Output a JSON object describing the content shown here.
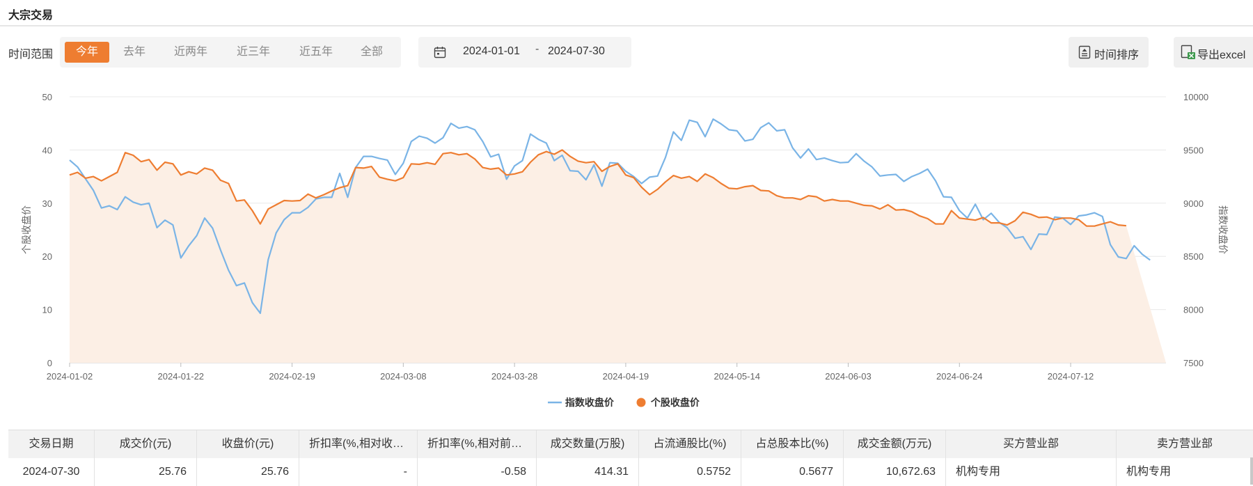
{
  "page": {
    "title": "大宗交易"
  },
  "filter": {
    "label": "时间范围",
    "tabs": [
      "今年",
      "去年",
      "近两年",
      "近三年",
      "近五年",
      "全部"
    ],
    "active_tab": "今年",
    "date_start": "2024-01-01",
    "date_sep": "-",
    "date_end": "2024-07-30"
  },
  "toolbar": {
    "sort_label": "时间排序",
    "sort_icon": "sort-doc-icon",
    "export_label": "导出excel",
    "export_icon": "excel-icon"
  },
  "chart_data": {
    "type": "line",
    "x": [
      "2024-01-02",
      "2024-01-03",
      "2024-01-04",
      "2024-01-05",
      "2024-01-08",
      "2024-01-09",
      "2024-01-10",
      "2024-01-11",
      "2024-01-12",
      "2024-01-15",
      "2024-01-16",
      "2024-01-17",
      "2024-01-18",
      "2024-01-19",
      "2024-01-22",
      "2024-01-23",
      "2024-01-24",
      "2024-01-25",
      "2024-01-26",
      "2024-01-29",
      "2024-01-30",
      "2024-01-31",
      "2024-02-01",
      "2024-02-02",
      "2024-02-05",
      "2024-02-06",
      "2024-02-07",
      "2024-02-08",
      "2024-02-19",
      "2024-02-20",
      "2024-02-21",
      "2024-02-22",
      "2024-02-23",
      "2024-02-26",
      "2024-02-27",
      "2024-02-28",
      "2024-02-29",
      "2024-03-01",
      "2024-03-04",
      "2024-03-05",
      "2024-03-06",
      "2024-03-07",
      "2024-03-08",
      "2024-03-11",
      "2024-03-12",
      "2024-03-13",
      "2024-03-14",
      "2024-03-15",
      "2024-03-18",
      "2024-03-19",
      "2024-03-20",
      "2024-03-21",
      "2024-03-22",
      "2024-03-25",
      "2024-03-26",
      "2024-03-27",
      "2024-03-28",
      "2024-03-29",
      "2024-04-01",
      "2024-04-02",
      "2024-04-03",
      "2024-04-08",
      "2024-04-09",
      "2024-04-10",
      "2024-04-11",
      "2024-04-12",
      "2024-04-15",
      "2024-04-16",
      "2024-04-17",
      "2024-04-18",
      "2024-04-19",
      "2024-04-22",
      "2024-04-23",
      "2024-04-24",
      "2024-04-25",
      "2024-04-26",
      "2024-04-29",
      "2024-04-30",
      "2024-05-06",
      "2024-05-07",
      "2024-05-08",
      "2024-05-09",
      "2024-05-10",
      "2024-05-13",
      "2024-05-14",
      "2024-05-15",
      "2024-05-16",
      "2024-05-17",
      "2024-05-20",
      "2024-05-21",
      "2024-05-22",
      "2024-05-23",
      "2024-05-24",
      "2024-05-27",
      "2024-05-28",
      "2024-05-29",
      "2024-05-30",
      "2024-05-31",
      "2024-06-03",
      "2024-06-04",
      "2024-06-05",
      "2024-06-06",
      "2024-06-07",
      "2024-06-11",
      "2024-06-12",
      "2024-06-13",
      "2024-06-14",
      "2024-06-17",
      "2024-06-18",
      "2024-06-19",
      "2024-06-20",
      "2024-06-21",
      "2024-06-24",
      "2024-06-25",
      "2024-06-26",
      "2024-06-27",
      "2024-06-28",
      "2024-07-01",
      "2024-07-02",
      "2024-07-03",
      "2024-07-04",
      "2024-07-05",
      "2024-07-08",
      "2024-07-09",
      "2024-07-10",
      "2024-07-11",
      "2024-07-12",
      "2024-07-15",
      "2024-07-16",
      "2024-07-17",
      "2024-07-18",
      "2024-07-19",
      "2024-07-22",
      "2024-07-23",
      "2024-07-24",
      "2024-07-25",
      "2024-07-26",
      "2024-07-29",
      "2024-07-30"
    ],
    "xticks": [
      "2024-01-02",
      "2024-01-22",
      "2024-02-19",
      "2024-03-08",
      "2024-03-28",
      "2024-04-19",
      "2024-05-14",
      "2024-06-03",
      "2024-06-24",
      "2024-07-12"
    ],
    "ylabel_left": "个股收盘价",
    "ylabel_right": "指数收盘价",
    "ylim_left": [
      0,
      50
    ],
    "ylim_right": [
      7500,
      10000
    ],
    "yticks_left": [
      0,
      10,
      20,
      30,
      40,
      50
    ],
    "yticks_right": [
      7500,
      8000,
      8500,
      9000,
      9500,
      10000
    ],
    "grid": true,
    "legend_position": "bottom-center",
    "series": [
      {
        "name": "指数收盘价",
        "axis": "right",
        "color": "#7ab4e6",
        "values": [
          9405,
          9340,
          9230,
          9120,
          8955,
          8975,
          8940,
          9060,
          9010,
          8985,
          9000,
          8770,
          8840,
          8795,
          8485,
          8600,
          8695,
          8860,
          8765,
          8560,
          8370,
          8225,
          8250,
          8065,
          7965,
          8470,
          8720,
          8845,
          8910,
          8910,
          8960,
          9040,
          9055,
          9055,
          9280,
          9055,
          9335,
          9440,
          9440,
          9420,
          9405,
          9270,
          9375,
          9580,
          9630,
          9610,
          9565,
          9615,
          9750,
          9705,
          9720,
          9690,
          9580,
          9435,
          9460,
          9225,
          9350,
          9400,
          9650,
          9600,
          9565,
          9400,
          9450,
          9305,
          9300,
          9220,
          9360,
          9160,
          9380,
          9375,
          9300,
          9250,
          9185,
          9245,
          9255,
          9430,
          9670,
          9590,
          9780,
          9760,
          9625,
          9790,
          9745,
          9690,
          9680,
          9585,
          9600,
          9710,
          9755,
          9680,
          9690,
          9520,
          9425,
          9510,
          9410,
          9425,
          9400,
          9380,
          9385,
          9465,
          9395,
          9340,
          9255,
          9265,
          9270,
          9205,
          9250,
          9280,
          9320,
          9210,
          9060,
          9055,
          8930,
          8860,
          8990,
          8845,
          8905,
          8820,
          8770,
          8670,
          8685,
          8565,
          8710,
          8705,
          8870,
          8860,
          8800,
          8880,
          8890,
          8910,
          8875,
          8610,
          8495,
          8480,
          8600,
          8520,
          8465
        ],
        "color_name": "blue"
      },
      {
        "name": "个股收盘价",
        "axis": "left",
        "color": "#ee7d31",
        "fill": "#fcefe5",
        "values": [
          35.3,
          35.8,
          34.7,
          35.0,
          34.2,
          35.0,
          35.8,
          39.5,
          39.0,
          37.8,
          38.2,
          36.2,
          37.7,
          37.4,
          35.3,
          35.9,
          35.5,
          36.6,
          36.2,
          34.3,
          33.7,
          30.4,
          30.6,
          28.6,
          26.1,
          28.9,
          29.7,
          30.5,
          30.4,
          30.5,
          31.7,
          31.0,
          31.6,
          32.3,
          32.9,
          33.3,
          36.7,
          36.6,
          36.9,
          34.9,
          34.5,
          34.2,
          34.8,
          37.4,
          37.3,
          37.6,
          37.3,
          39.3,
          39.5,
          39.1,
          39.3,
          38.3,
          36.7,
          36.4,
          36.6,
          35.3,
          35.5,
          35.9,
          37.7,
          39.1,
          39.7,
          39.2,
          40.0,
          38.8,
          37.9,
          37.6,
          37.8,
          36.0,
          36.9,
          37.4,
          35.3,
          34.8,
          33.0,
          31.6,
          32.6,
          34.0,
          35.2,
          34.7,
          35.0,
          34.1,
          35.5,
          34.8,
          33.7,
          32.8,
          32.7,
          33.1,
          33.3,
          32.4,
          32.3,
          31.4,
          31.0,
          31.0,
          30.7,
          31.4,
          31.2,
          30.4,
          30.7,
          30.4,
          30.4,
          30.0,
          29.6,
          29.5,
          28.9,
          29.7,
          28.7,
          28.8,
          28.4,
          27.6,
          27.1,
          26.1,
          26.1,
          28.6,
          27.2,
          27.0,
          26.8,
          27.3,
          26.3,
          26.3,
          25.9,
          26.7,
          28.3,
          27.9,
          27.3,
          27.4,
          26.9,
          27.2,
          27.2,
          26.9,
          25.7,
          25.7,
          26.1,
          26.5,
          25.9,
          25.76
        ],
        "color_name": "orange"
      }
    ]
  },
  "table": {
    "columns": [
      "交易日期",
      "成交价(元)",
      "收盘价(元)",
      "折扣率(%,相对收盘价)",
      "折扣率(%,相对前收盘价)",
      "成交数量(万股)",
      "占流通股比(%)",
      "占总股本比(%)",
      "成交金额(万元)",
      "买方营业部",
      "卖方营业部"
    ],
    "rows": [
      [
        "2024-07-30",
        "25.76",
        "25.76",
        "-",
        "-0.58",
        "414.31",
        "0.5752",
        "0.5677",
        "10,672.63",
        "机构专用",
        "机构专用"
      ]
    ]
  }
}
